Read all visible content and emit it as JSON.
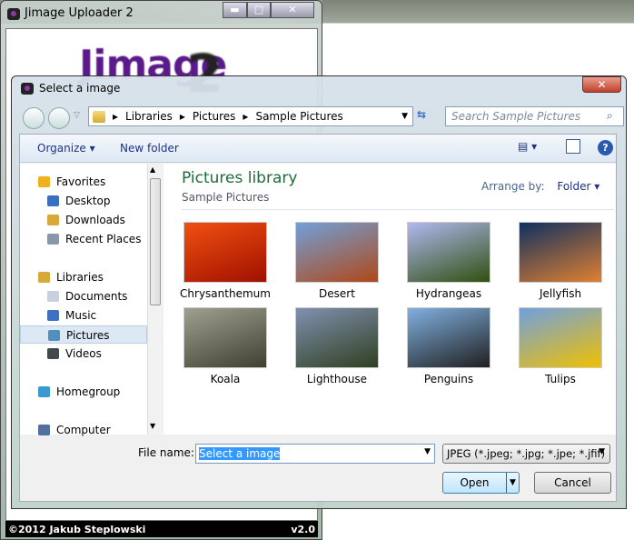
{
  "main_window": {
    "title": "Jimage Uploader 2",
    "logo_text": "Jimage",
    "logo_number": "2",
    "footer_left": "©2012 Jakub Steplowski",
    "footer_right": "v2.0"
  },
  "dialog": {
    "title": "Select a image",
    "breadcrumb": [
      "Libraries",
      "Pictures",
      "Sample Pictures"
    ],
    "search_placeholder": "Search Sample Pictures",
    "toolbar": {
      "organize": "Organize",
      "new_folder": "New folder"
    },
    "nav": [
      {
        "label": "Favorites",
        "top": true,
        "color": "#f0b020"
      },
      {
        "label": "Desktop",
        "color": "#3a70c0"
      },
      {
        "label": "Downloads",
        "color": "#d8a838"
      },
      {
        "label": "Recent Places",
        "color": "#8898a8"
      },
      {
        "label": "Libraries",
        "top": true,
        "color": "#d8a838"
      },
      {
        "label": "Documents",
        "color": "#c8d0e0"
      },
      {
        "label": "Music",
        "color": "#4070c0"
      },
      {
        "label": "Pictures",
        "color": "#5090c0",
        "selected": true
      },
      {
        "label": "Videos",
        "color": "#404850"
      },
      {
        "label": "Homegroup",
        "top": true,
        "color": "#3a9ad0"
      },
      {
        "label": "Computer",
        "top": true,
        "color": "#5070a0"
      }
    ],
    "library_title": "Pictures library",
    "library_subtitle": "Sample Pictures",
    "arrange_by_label": "Arrange by:",
    "arrange_by_value": "Folder",
    "pictures": [
      {
        "name": "Chrysanthemum",
        "colors": [
          "#f05010",
          "#a01000"
        ]
      },
      {
        "name": "Desert",
        "colors": [
          "#70a0d8",
          "#b04818"
        ]
      },
      {
        "name": "Hydrangeas",
        "colors": [
          "#b0b8f0",
          "#305010"
        ]
      },
      {
        "name": "Jellyfish",
        "colors": [
          "#103060",
          "#e08030"
        ]
      },
      {
        "name": "Koala",
        "colors": [
          "#a0a090",
          "#404030"
        ]
      },
      {
        "name": "Lighthouse",
        "colors": [
          "#8090b0",
          "#304020"
        ]
      },
      {
        "name": "Penguins",
        "colors": [
          "#80b0e0",
          "#202020"
        ]
      },
      {
        "name": "Tulips",
        "colors": [
          "#70a0e0",
          "#f0c000"
        ]
      }
    ],
    "file_name_label": "File name:",
    "file_name_value": "Select a image",
    "file_type": "JPEG (*.jpeg; *.jpg; *.jpe; *.jfif)",
    "open_label": "Open",
    "cancel_label": "Cancel"
  }
}
